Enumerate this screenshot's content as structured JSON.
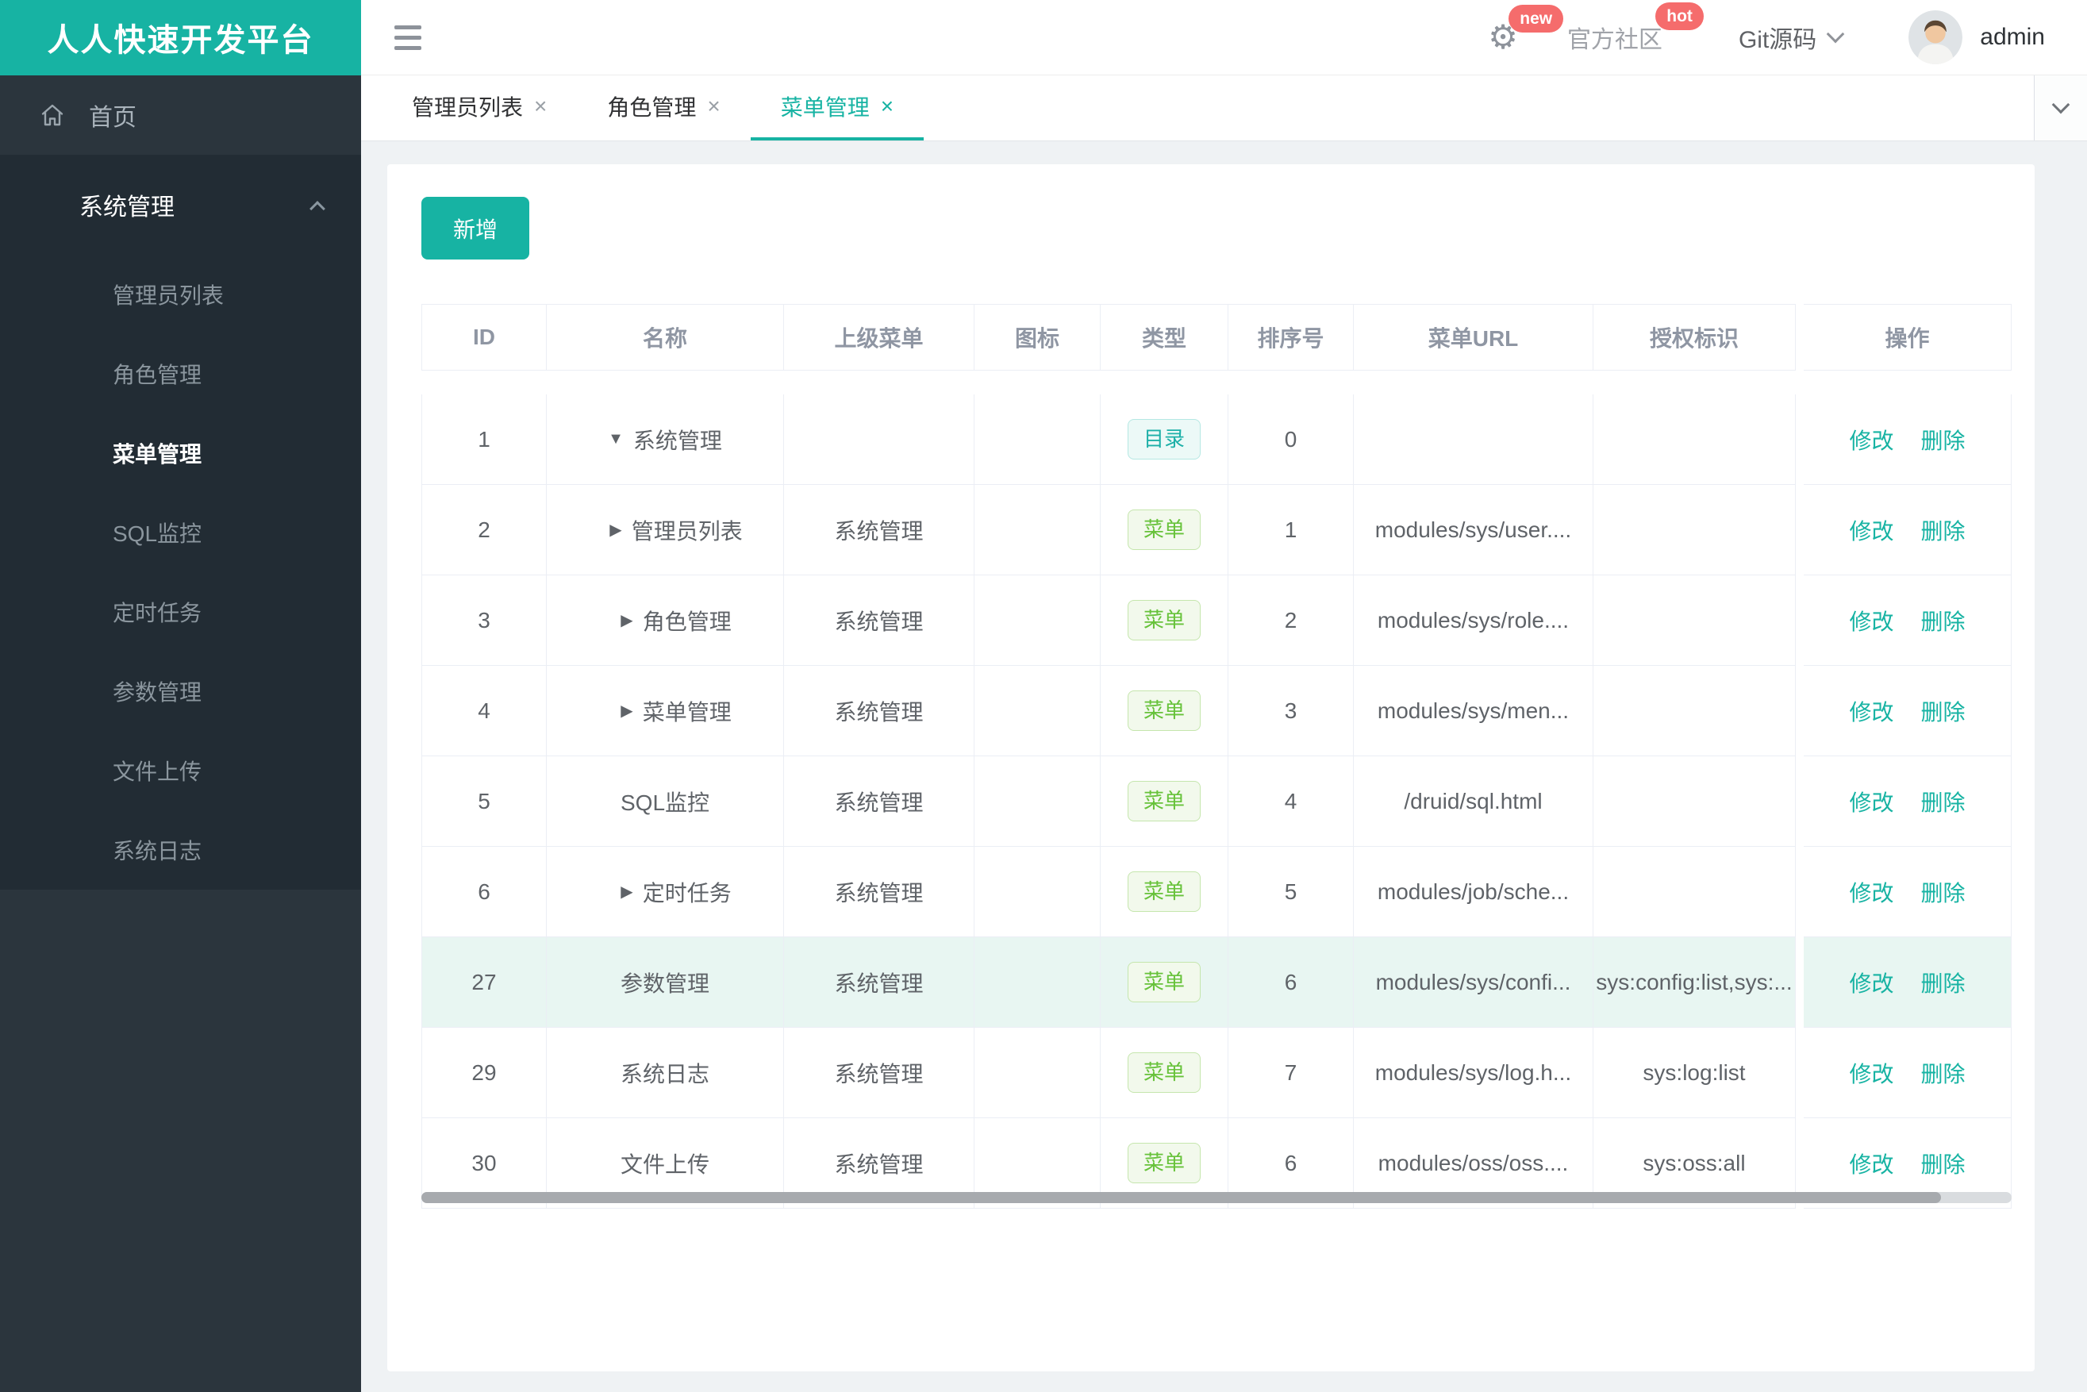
{
  "app": {
    "title": "人人快速开发平台"
  },
  "header": {
    "gear_badge": "new",
    "community_label": "官方社区",
    "community_badge": "hot",
    "git_label": "Git源码",
    "username": "admin"
  },
  "sidebar": {
    "home_label": "首页",
    "group_label": "系统管理",
    "items": [
      "管理员列表",
      "角色管理",
      "菜单管理",
      "SQL监控",
      "定时任务",
      "参数管理",
      "文件上传",
      "系统日志"
    ],
    "active_item": "菜单管理"
  },
  "tabs": [
    {
      "label": "管理员列表"
    },
    {
      "label": "角色管理"
    },
    {
      "label": "菜单管理",
      "active": true
    }
  ],
  "toolbar": {
    "add_label": "新增"
  },
  "table": {
    "columns": [
      "ID",
      "名称",
      "上级菜单",
      "图标",
      "类型",
      "排序号",
      "菜单URL",
      "授权标识",
      "操作"
    ],
    "ops": {
      "edit": "修改",
      "delete": "删除"
    },
    "rows": [
      {
        "id": "1",
        "arrow": "down",
        "name": "系统管理",
        "parent": "",
        "type": "目录",
        "type_kind": "dir",
        "sort": "0",
        "url": "",
        "auth": ""
      },
      {
        "id": "2",
        "arrow": "right",
        "child": true,
        "name": "管理员列表",
        "parent": "系统管理",
        "type": "菜单",
        "type_kind": "menu",
        "sort": "1",
        "url": "modules/sys/user....",
        "auth": ""
      },
      {
        "id": "3",
        "arrow": "right",
        "child": true,
        "name": "角色管理",
        "parent": "系统管理",
        "type": "菜单",
        "type_kind": "menu",
        "sort": "2",
        "url": "modules/sys/role....",
        "auth": ""
      },
      {
        "id": "4",
        "arrow": "right",
        "child": true,
        "name": "菜单管理",
        "parent": "系统管理",
        "type": "菜单",
        "type_kind": "menu",
        "sort": "3",
        "url": "modules/sys/men...",
        "auth": ""
      },
      {
        "id": "5",
        "name": "SQL监控",
        "parent": "系统管理",
        "type": "菜单",
        "type_kind": "menu",
        "sort": "4",
        "url": "/druid/sql.html",
        "auth": ""
      },
      {
        "id": "6",
        "arrow": "right",
        "child": true,
        "name": "定时任务",
        "parent": "系统管理",
        "type": "菜单",
        "type_kind": "menu",
        "sort": "5",
        "url": "modules/job/sche...",
        "auth": ""
      },
      {
        "id": "27",
        "name": "参数管理",
        "parent": "系统管理",
        "type": "菜单",
        "type_kind": "menu",
        "sort": "6",
        "url": "modules/sys/confi...",
        "auth": "sys:config:list,sys:...",
        "highlight": true
      },
      {
        "id": "29",
        "name": "系统日志",
        "parent": "系统管理",
        "type": "菜单",
        "type_kind": "menu",
        "sort": "7",
        "url": "modules/sys/log.h...",
        "auth": "sys:log:list"
      },
      {
        "id": "30",
        "name": "文件上传",
        "parent": "系统管理",
        "type": "菜单",
        "type_kind": "menu",
        "sort": "6",
        "url": "modules/oss/oss....",
        "auth": "sys:oss:all"
      }
    ]
  },
  "colors": {
    "accent_teal": "#17b3a3",
    "badge_red": "#f56c6c",
    "sidebar_bg": "#2b353d",
    "sidebar_submenu_bg": "#222c34",
    "row_highlight": "#e8f6f2",
    "tag_dir_text": "#1db0a8",
    "tag_menu_text": "#67c23a",
    "table_border": "#ebeef5"
  }
}
